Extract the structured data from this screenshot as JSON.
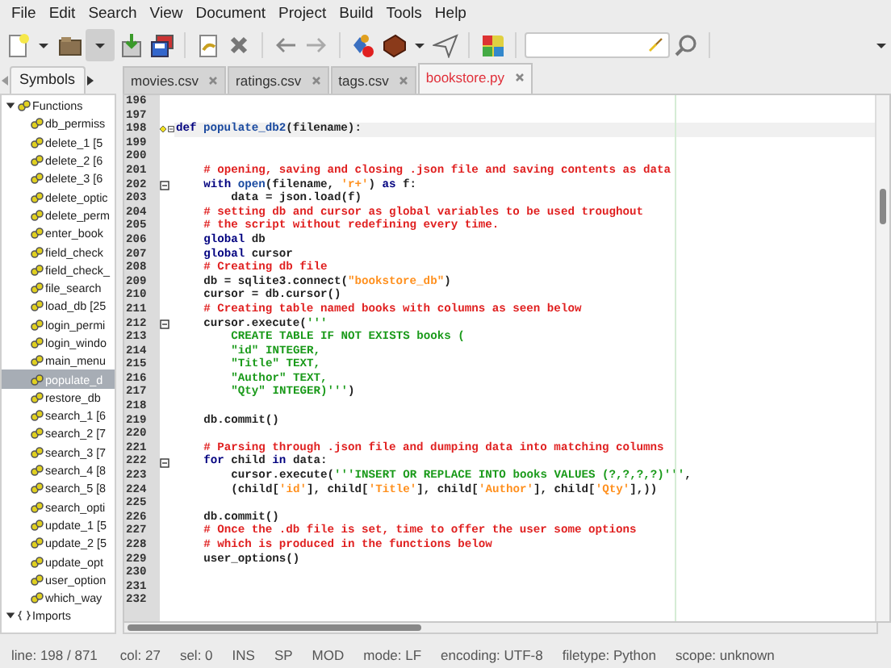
{
  "menu": [
    "File",
    "Edit",
    "Search",
    "View",
    "Document",
    "Project",
    "Build",
    "Tools",
    "Help"
  ],
  "toolbar": [
    {
      "kind": "new",
      "pressed": false
    },
    {
      "kind": "dropdown",
      "pressed": false
    },
    {
      "kind": "open",
      "pressed": false
    },
    {
      "kind": "dropdown",
      "pressed": true
    },
    {
      "kind": "save",
      "pressed": false
    },
    {
      "kind": "saveall",
      "pressed": false
    },
    {
      "kind": "sep"
    },
    {
      "kind": "revert",
      "pressed": false
    },
    {
      "kind": "close",
      "pressed": false
    },
    {
      "kind": "sep"
    },
    {
      "kind": "back",
      "pressed": false
    },
    {
      "kind": "forward",
      "pressed": false
    },
    {
      "kind": "sep"
    },
    {
      "kind": "compile",
      "pressed": false
    },
    {
      "kind": "build",
      "pressed": false
    },
    {
      "kind": "dropdown",
      "pressed": false
    },
    {
      "kind": "send",
      "pressed": false
    },
    {
      "kind": "sep"
    },
    {
      "kind": "color",
      "pressed": false
    },
    {
      "kind": "sep"
    },
    {
      "kind": "search"
    },
    {
      "kind": "find",
      "pressed": false
    },
    {
      "kind": "sep"
    },
    {
      "kind": "more",
      "pressed": false
    }
  ],
  "sidebar": {
    "tab": "Symbols",
    "tree": [
      {
        "label": "Functions",
        "kind": "functions",
        "expanded": true,
        "selected": false,
        "children": [
          {
            "label": "db_permiss",
            "selected": false
          },
          {
            "label": "delete_1 [5",
            "selected": false
          },
          {
            "label": "delete_2 [6",
            "selected": false
          },
          {
            "label": "delete_3 [6",
            "selected": false
          },
          {
            "label": "delete_optic",
            "selected": false
          },
          {
            "label": "delete_perm",
            "selected": false
          },
          {
            "label": "enter_book",
            "selected": false
          },
          {
            "label": "field_check",
            "selected": false
          },
          {
            "label": "field_check_",
            "selected": false
          },
          {
            "label": "file_search",
            "selected": false
          },
          {
            "label": "load_db [25",
            "selected": false
          },
          {
            "label": "login_permi",
            "selected": false
          },
          {
            "label": "login_windo",
            "selected": false
          },
          {
            "label": "main_menu",
            "selected": false
          },
          {
            "label": "populate_d",
            "selected": true
          },
          {
            "label": "restore_db",
            "selected": false
          },
          {
            "label": "search_1 [6",
            "selected": false
          },
          {
            "label": "search_2 [7",
            "selected": false
          },
          {
            "label": "search_3 [7",
            "selected": false
          },
          {
            "label": "search_4 [8",
            "selected": false
          },
          {
            "label": "search_5 [8",
            "selected": false
          },
          {
            "label": "search_opti",
            "selected": false
          },
          {
            "label": "update_1 [5",
            "selected": false
          },
          {
            "label": "update_2 [5",
            "selected": false
          },
          {
            "label": "update_opt",
            "selected": false
          },
          {
            "label": "user_option",
            "selected": false
          },
          {
            "label": "which_way",
            "selected": false
          }
        ]
      },
      {
        "label": "Imports",
        "kind": "imports",
        "expanded": true,
        "selected": false
      }
    ]
  },
  "tabs": [
    {
      "label": "movies.csv",
      "selected": false,
      "modified": false
    },
    {
      "label": "ratings.csv",
      "selected": false,
      "modified": false
    },
    {
      "label": "tags.csv",
      "selected": false,
      "modified": false
    },
    {
      "label": "bookstore.py",
      "selected": true,
      "modified": true
    }
  ],
  "editor": {
    "lines": [
      {
        "num": "196",
        "kind": "top",
        "fold": false,
        "current": false
      },
      {
        "num": "197",
        "kind": "top",
        "fold": false,
        "current": false
      },
      {
        "num": "198",
        "kind": "top",
        "fold": true,
        "current": true,
        "tokens": [
          {
            "kind": "kw",
            "text": "def "
          },
          {
            "kind": "fn",
            "text": "populate_db2"
          },
          {
            "kind": "plain",
            "text": "(filename):"
          }
        ]
      },
      {
        "num": "199",
        "kind": "top",
        "fold": false,
        "current": false
      },
      {
        "num": "200",
        "kind": "top",
        "fold": false,
        "current": false
      },
      {
        "num": "201",
        "kind": "body",
        "fold": false,
        "current": false,
        "tokens": [
          {
            "kind": "cmt",
            "text": "# opening, saving and closing .json file and saving contents as data"
          }
        ]
      },
      {
        "num": "202",
        "kind": "body",
        "fold": true,
        "current": false,
        "tokens": [
          {
            "kind": "kw",
            "text": "with "
          },
          {
            "kind": "fn",
            "text": "open"
          },
          {
            "kind": "plain",
            "text": "(filename, "
          },
          {
            "kind": "str",
            "text": "'r+'"
          },
          {
            "kind": "plain",
            "text": ") "
          },
          {
            "kind": "kw",
            "text": "as"
          },
          {
            "kind": "plain",
            "text": " f:"
          }
        ]
      },
      {
        "num": "203",
        "kind": "inner",
        "fold": false,
        "current": false,
        "tokens": [
          {
            "kind": "plain",
            "text": "data = json.load(f)"
          }
        ]
      },
      {
        "num": "204",
        "kind": "body",
        "fold": false,
        "current": false,
        "tokens": [
          {
            "kind": "cmt",
            "text": "# setting db and cursor as global variables to be used troughout"
          }
        ]
      },
      {
        "num": "205",
        "kind": "body",
        "fold": false,
        "current": false,
        "tokens": [
          {
            "kind": "cmt",
            "text": "# the script without redefining every time."
          }
        ]
      },
      {
        "num": "206",
        "kind": "body",
        "fold": false,
        "current": false,
        "tokens": [
          {
            "kind": "kw",
            "text": "global"
          },
          {
            "kind": "plain",
            "text": " db"
          }
        ]
      },
      {
        "num": "207",
        "kind": "body",
        "fold": false,
        "current": false,
        "tokens": [
          {
            "kind": "kw",
            "text": "global"
          },
          {
            "kind": "plain",
            "text": " cursor"
          }
        ]
      },
      {
        "num": "208",
        "kind": "body",
        "fold": false,
        "current": false,
        "tokens": [
          {
            "kind": "cmt",
            "text": "# Creating db file"
          }
        ]
      },
      {
        "num": "209",
        "kind": "body",
        "fold": false,
        "current": false,
        "tokens": [
          {
            "kind": "plain",
            "text": "db = sqlite3.connect("
          },
          {
            "kind": "str",
            "text": "\"bookstore_db\""
          },
          {
            "kind": "plain",
            "text": ")"
          }
        ]
      },
      {
        "num": "210",
        "kind": "body",
        "fold": false,
        "current": false,
        "tokens": [
          {
            "kind": "plain",
            "text": "cursor = db.cursor()"
          }
        ]
      },
      {
        "num": "211",
        "kind": "body",
        "fold": false,
        "current": false,
        "tokens": [
          {
            "kind": "cmt",
            "text": "# Creating table named books with columns as seen below"
          }
        ]
      },
      {
        "num": "212",
        "kind": "body",
        "fold": true,
        "current": false,
        "tokens": [
          {
            "kind": "plain",
            "text": "cursor.execute("
          },
          {
            "kind": "sql",
            "text": "'''"
          }
        ]
      },
      {
        "num": "213",
        "kind": "inner",
        "fold": false,
        "current": false,
        "tokens": [
          {
            "kind": "sql",
            "text": "CREATE TABLE IF NOT EXISTS books ("
          }
        ]
      },
      {
        "num": "214",
        "kind": "inner",
        "fold": false,
        "current": false,
        "tokens": [
          {
            "kind": "sql",
            "text": "\"id\" INTEGER,"
          }
        ]
      },
      {
        "num": "215",
        "kind": "inner",
        "fold": false,
        "current": false,
        "tokens": [
          {
            "kind": "sql",
            "text": "\"Title\" TEXT,"
          }
        ]
      },
      {
        "num": "216",
        "kind": "inner",
        "fold": false,
        "current": false,
        "tokens": [
          {
            "kind": "sql",
            "text": "\"Author\" TEXT,"
          }
        ]
      },
      {
        "num": "217",
        "kind": "inner",
        "fold": false,
        "current": false,
        "tokens": [
          {
            "kind": "sql",
            "text": "\"Qty\" INTEGER)'''"
          },
          {
            "kind": "plain",
            "text": ")"
          }
        ]
      },
      {
        "num": "218",
        "kind": "top",
        "fold": false,
        "current": false
      },
      {
        "num": "219",
        "kind": "body",
        "fold": false,
        "current": false,
        "tokens": [
          {
            "kind": "plain",
            "text": "db.commit()"
          }
        ]
      },
      {
        "num": "220",
        "kind": "top",
        "fold": false,
        "current": false
      },
      {
        "num": "221",
        "kind": "body",
        "fold": false,
        "current": false,
        "tokens": [
          {
            "kind": "cmt",
            "text": "# Parsing through .json file and dumping data into matching columns"
          }
        ]
      },
      {
        "num": "222",
        "kind": "body",
        "fold": true,
        "current": false,
        "tokens": [
          {
            "kind": "kw",
            "text": "for"
          },
          {
            "kind": "plain",
            "text": " child "
          },
          {
            "kind": "kw",
            "text": "in"
          },
          {
            "kind": "plain",
            "text": " data:"
          }
        ]
      },
      {
        "num": "223",
        "kind": "inner",
        "fold": false,
        "current": false,
        "tokens": [
          {
            "kind": "plain",
            "text": "cursor.execute("
          },
          {
            "kind": "sql",
            "text": "'''INSERT OR REPLACE INTO books VALUES (?,?,?,?)'''"
          },
          {
            "kind": "plain",
            "text": ","
          }
        ]
      },
      {
        "num": "224",
        "kind": "inner",
        "fold": false,
        "current": false,
        "tokens": [
          {
            "kind": "plain",
            "text": "(child["
          },
          {
            "kind": "str",
            "text": "'id'"
          },
          {
            "kind": "plain",
            "text": "], child["
          },
          {
            "kind": "str",
            "text": "'Title'"
          },
          {
            "kind": "plain",
            "text": "], child["
          },
          {
            "kind": "str",
            "text": "'Author'"
          },
          {
            "kind": "plain",
            "text": "], child["
          },
          {
            "kind": "str",
            "text": "'Qty'"
          },
          {
            "kind": "plain",
            "text": "],))"
          }
        ]
      },
      {
        "num": "225",
        "kind": "top",
        "fold": false,
        "current": false
      },
      {
        "num": "226",
        "kind": "body",
        "fold": false,
        "current": false,
        "tokens": [
          {
            "kind": "plain",
            "text": "db.commit()"
          }
        ]
      },
      {
        "num": "227",
        "kind": "body",
        "fold": false,
        "current": false,
        "tokens": [
          {
            "kind": "cmt",
            "text": "# Once the .db file is set, time to offer the user some options"
          }
        ]
      },
      {
        "num": "228",
        "kind": "body",
        "fold": false,
        "current": false,
        "tokens": [
          {
            "kind": "cmt",
            "text": "# which is produced in the functions below"
          }
        ]
      },
      {
        "num": "229",
        "kind": "body",
        "fold": false,
        "current": false,
        "tokens": [
          {
            "kind": "plain",
            "text": "user_options()"
          }
        ]
      },
      {
        "num": "230",
        "kind": "top",
        "fold": false,
        "current": false
      },
      {
        "num": "231",
        "kind": "top",
        "fold": false,
        "current": false
      },
      {
        "num": "232",
        "kind": "top",
        "fold": false,
        "current": false
      }
    ]
  },
  "status_bar": [
    "line: 198 / 871",
    "col: 27",
    "sel: 0",
    "INS",
    "SP",
    "MOD",
    "mode: LF",
    "encoding: UTF-8",
    "filetype: Python",
    "scope: unknown"
  ]
}
